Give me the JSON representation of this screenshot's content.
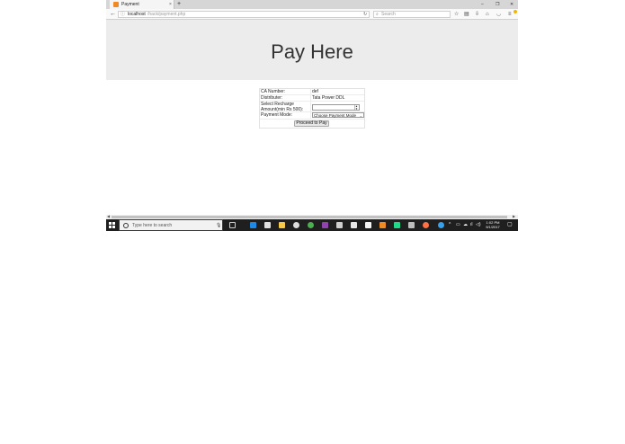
{
  "browser": {
    "tab_title": "Payment",
    "tab_close": "×",
    "new_tab": "+",
    "win_minimize": "–",
    "win_restore": "❐",
    "win_close": "✕",
    "url_host": "localhost",
    "url_path": "/hack/payment.php",
    "search_placeholder": "Search",
    "icons": [
      "back-icon",
      "info-icon",
      "reload-icon",
      "search-icon",
      "star-icon",
      "library-icon",
      "download-icon",
      "home-icon",
      "pocket-icon",
      "menu-icon"
    ]
  },
  "page": {
    "title": "Pay Here",
    "form": {
      "ca_label": "CA Number:",
      "ca_value": "def",
      "distributor_label": "Distributer:",
      "distributor_value": "Tata Power DDL",
      "amount_label": "Select Recharge Amount(min Rs 500):",
      "amount_value": "",
      "payment_label": "Payment Mode:",
      "payment_selected": "Choose Payment Mode",
      "submit_label": "Proceed to Pay"
    }
  },
  "taskbar": {
    "search_placeholder": "Type here to search",
    "time": "1:02 PM",
    "date": "9/1/2017",
    "apps": [
      "task-view",
      "edge",
      "store",
      "file-explorer",
      "chrome-alt",
      "chrome",
      "visual-studio",
      "calculator",
      "mail",
      "notepad",
      "xampp",
      "pycharm",
      "paint",
      "firefox"
    ]
  },
  "colors": {
    "banner_bg": "#ececec",
    "taskbar_bg": "#1f1f1f",
    "tab_favicon": "#f08a24"
  }
}
